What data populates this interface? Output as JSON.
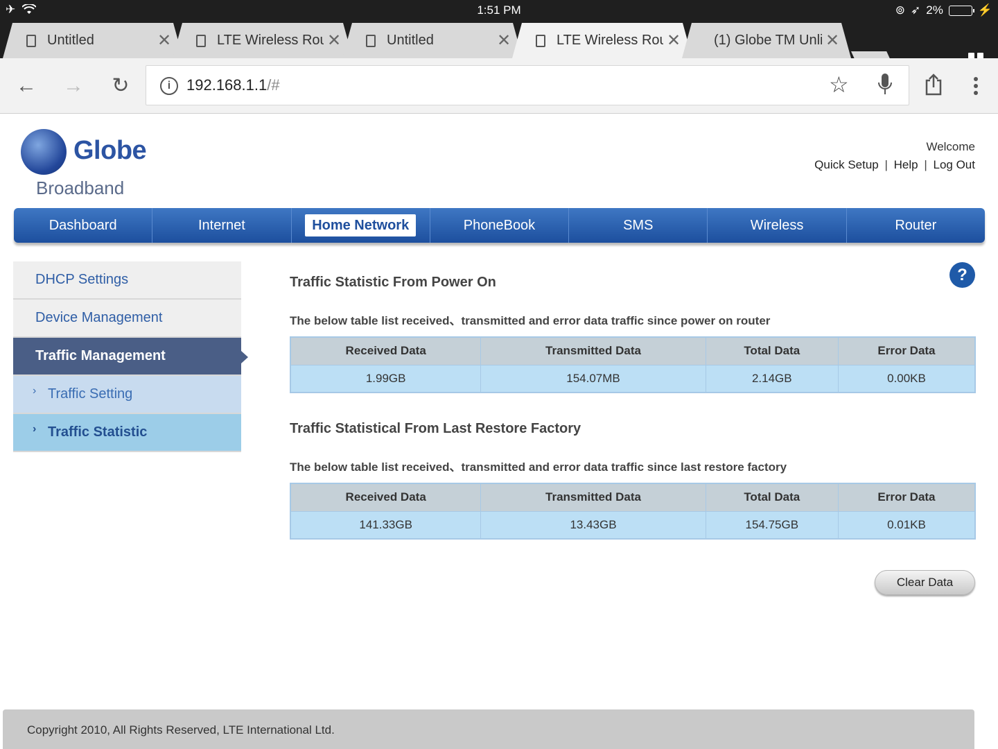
{
  "status_bar": {
    "time": "1:51 PM",
    "battery": "2%"
  },
  "browser": {
    "tabs": [
      {
        "title": "Untitled",
        "active": false
      },
      {
        "title": "LTE Wireless Rout",
        "active": false
      },
      {
        "title": "Untitled",
        "active": false
      },
      {
        "title": "LTE Wireless Rout",
        "active": true
      },
      {
        "title": "(1) Globe TM Unli",
        "active": false
      }
    ],
    "url_host": "192.168.1.1",
    "url_path": "/#",
    "close_glyph": "✕"
  },
  "header": {
    "logo_text": "Globe",
    "logo_sub": "Broadband",
    "welcome": "Welcome",
    "links": [
      "Quick Setup",
      "Help",
      "Log Out"
    ],
    "sep": "|"
  },
  "nav": {
    "items": [
      "Dashboard",
      "Internet",
      "Home Network",
      "PhoneBook",
      "SMS",
      "Wireless",
      "Router"
    ]
  },
  "sidebar": {
    "items": [
      {
        "label": "DHCP Settings"
      },
      {
        "label": "Device Management"
      },
      {
        "label": "Traffic Management"
      },
      {
        "label": "Traffic Setting"
      },
      {
        "label": "Traffic Statistic"
      }
    ]
  },
  "help": "?",
  "section1": {
    "title": "Traffic Statistic From Power On",
    "desc": "The below table list received、transmitted and error data traffic since power on router",
    "headers": [
      "Received Data",
      "Transmitted Data",
      "Total Data",
      "Error Data"
    ],
    "values": [
      "1.99GB",
      "154.07MB",
      "2.14GB",
      "0.00KB"
    ]
  },
  "section2": {
    "title": "Traffic Statistical From Last Restore Factory",
    "desc": "The below table list received、transmitted and error data traffic since last restore factory",
    "headers": [
      "Received Data",
      "Transmitted Data",
      "Total Data",
      "Error Data"
    ],
    "values": [
      "141.33GB",
      "13.43GB",
      "154.75GB",
      "0.01KB"
    ]
  },
  "clear_button": "Clear Data",
  "footer": "Copyright 2010, All Rights Reserved, LTE International Ltd."
}
